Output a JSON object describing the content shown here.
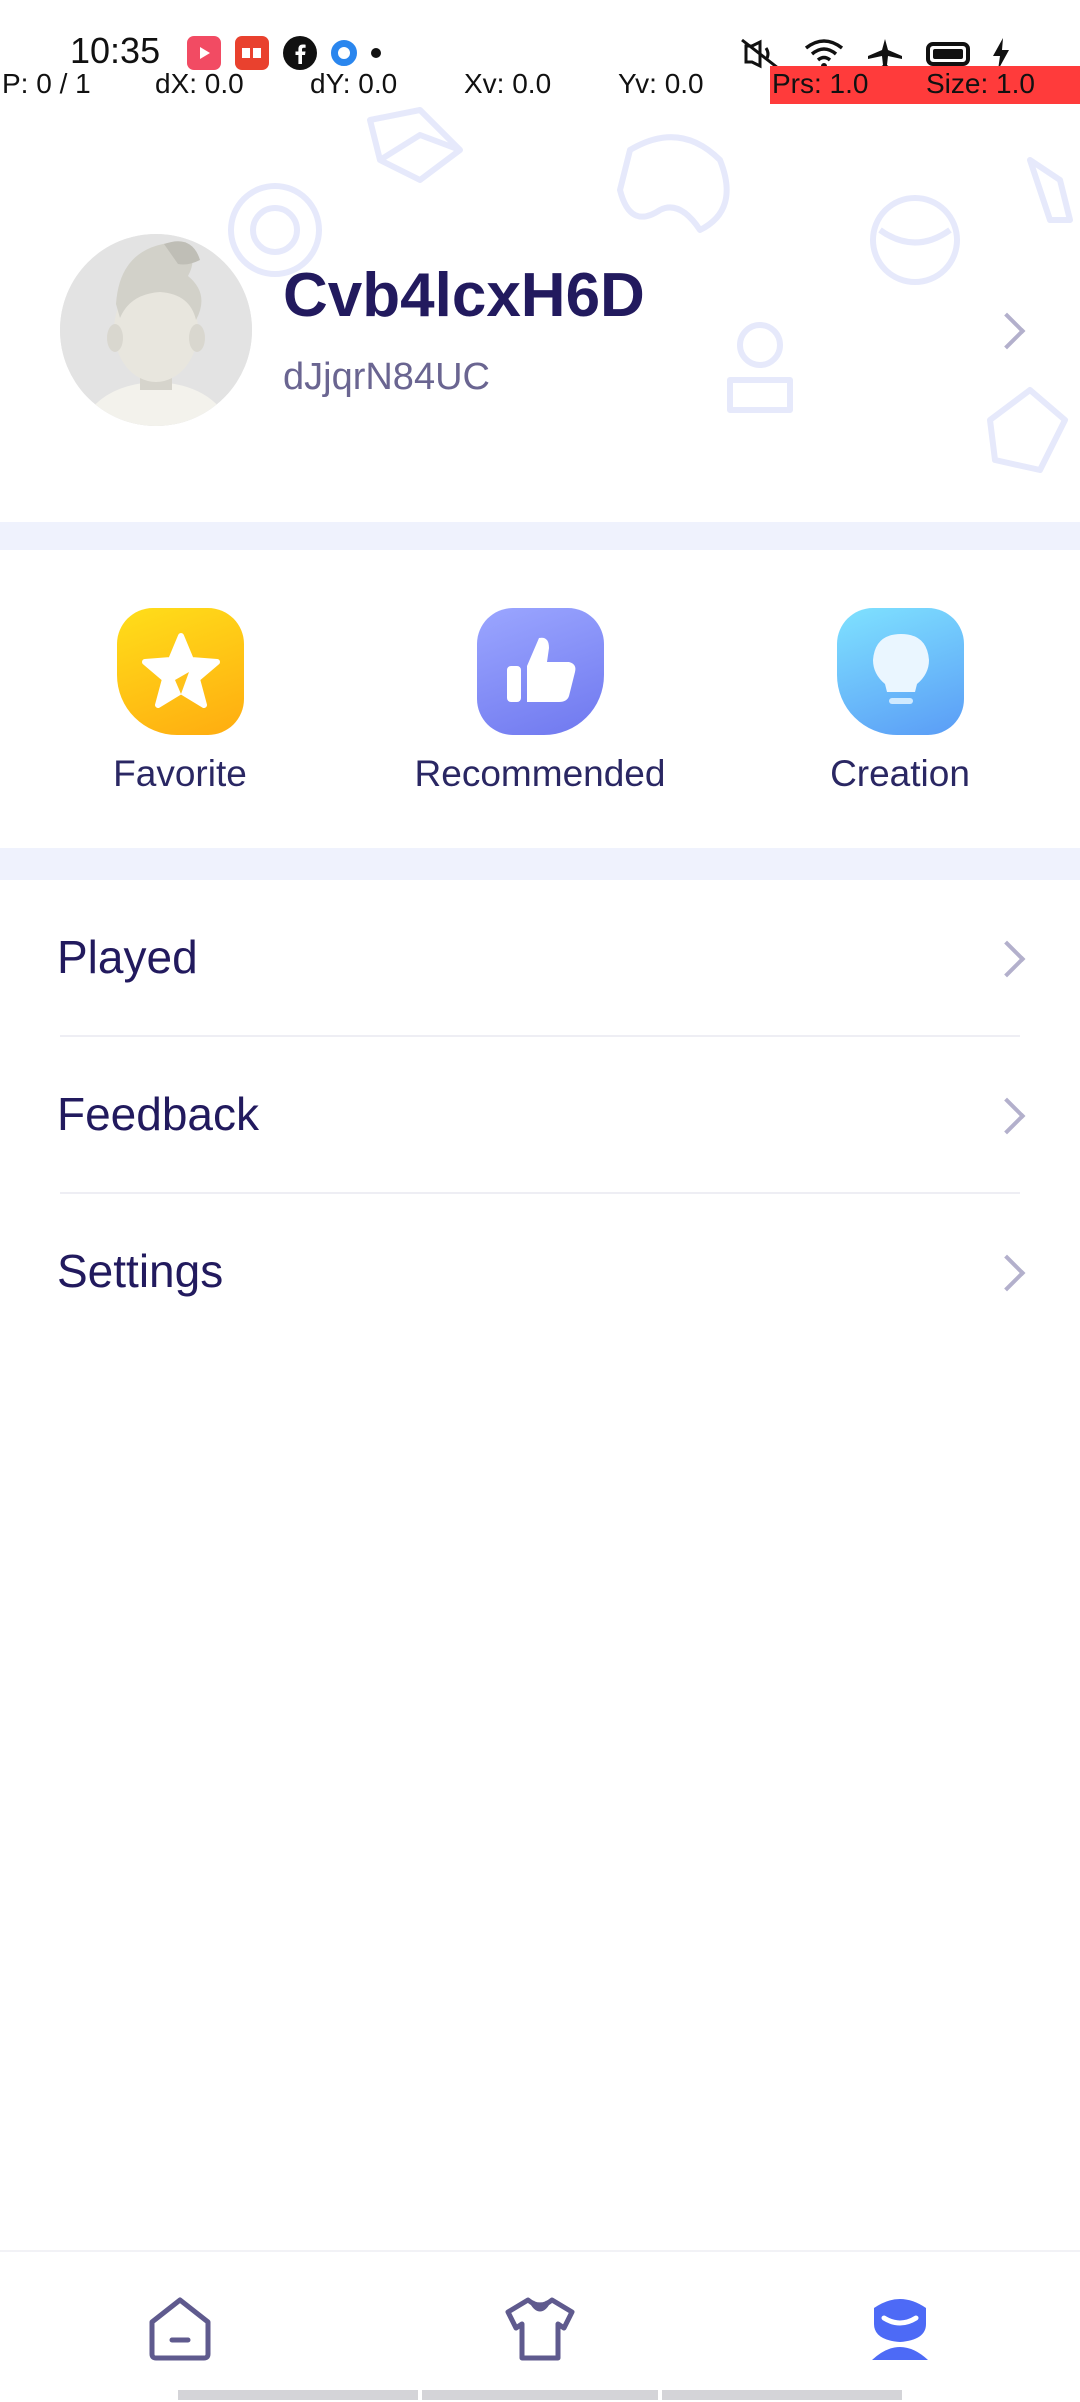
{
  "status_bar": {
    "time": "10:35",
    "notification_icons": [
      "video-app-icon",
      "news-app-icon",
      "facebook-icon",
      "blue-dot-app-icon",
      "more-dot-icon"
    ],
    "system_icons": [
      "mute-icon",
      "wifi-icon",
      "airplane-icon",
      "battery-icon",
      "charging-icon"
    ]
  },
  "debug_overlay": {
    "pointer": "P: 0 / 1",
    "dx": "dX: 0.0",
    "dy": "dY: 0.0",
    "xv": "Xv: 0.0",
    "yv": "Yv: 0.0",
    "prs": "Prs: 1.0",
    "size": "Size: 1.0"
  },
  "profile": {
    "username": "Cvb4lcxH6D",
    "user_id": "dJjqrN84UC"
  },
  "quick_actions": [
    {
      "label": "Favorite",
      "icon": "star-icon"
    },
    {
      "label": "Recommended",
      "icon": "thumbs-up-icon"
    },
    {
      "label": "Creation",
      "icon": "lightbulb-icon"
    }
  ],
  "menu": [
    {
      "label": "Played"
    },
    {
      "label": "Feedback"
    },
    {
      "label": "Settings"
    }
  ],
  "bottom_nav": [
    {
      "icon": "home-icon",
      "active": false
    },
    {
      "icon": "shirt-icon",
      "active": false
    },
    {
      "icon": "profile-icon",
      "active": true
    }
  ],
  "colors": {
    "primary_text": "#221a5e",
    "secondary_text": "#6a6591",
    "separator_band": "#eff2fd",
    "active_nav": "#4d6af6",
    "inactive_nav": "#5f5a8e"
  }
}
